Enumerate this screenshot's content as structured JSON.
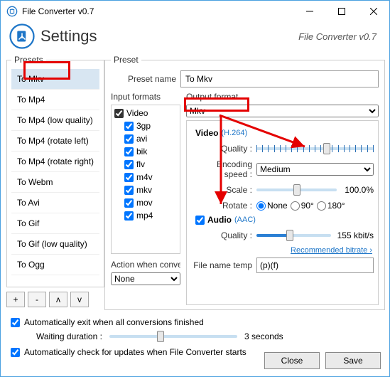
{
  "window": {
    "title": "File Converter v0.7",
    "subtitle": "File Converter v0.7",
    "heading": "Settings"
  },
  "legends": {
    "presets": "Presets",
    "preset": "Preset"
  },
  "presets": {
    "items": [
      {
        "label": "To Mkv"
      },
      {
        "label": "To Mp4"
      },
      {
        "label": "To Mp4 (low quality)"
      },
      {
        "label": "To Mp4 (rotate left)"
      },
      {
        "label": "To Mp4 (rotate right)"
      },
      {
        "label": "To Webm"
      },
      {
        "label": "To Avi"
      },
      {
        "label": "To Gif"
      },
      {
        "label": "To Gif (low quality)"
      },
      {
        "label": "To Ogg"
      }
    ],
    "buttons": {
      "add": "+",
      "remove": "-",
      "up": "ᴧ",
      "down": "v"
    }
  },
  "preset": {
    "name_label": "Preset name",
    "name_value": "To Mkv",
    "input_formats_label": "Input formats",
    "formats": [
      {
        "label": "Video",
        "checked": true,
        "icon": true
      },
      {
        "label": "3gp",
        "checked": true
      },
      {
        "label": "avi",
        "checked": true
      },
      {
        "label": "bik",
        "checked": true
      },
      {
        "label": "flv",
        "checked": true
      },
      {
        "label": "m4v",
        "checked": true
      },
      {
        "label": "mkv",
        "checked": true
      },
      {
        "label": "mov",
        "checked": true
      },
      {
        "label": "mp4",
        "checked": true
      }
    ],
    "action_label": "Action when conversion",
    "action_value": "None",
    "output_label": "Output format",
    "output_value": "Mkv",
    "video": {
      "heading": "Video",
      "codec": "(H.264)",
      "quality_label": "Quality :",
      "speed_label": "Encoding speed :",
      "speed_value": "Medium",
      "scale_label": "Scale :",
      "scale_value": "100.0%",
      "rotate_label": "Rotate :",
      "rotate_options": [
        "None",
        "90°",
        "180°"
      ],
      "rotate_selected": "None"
    },
    "audio": {
      "heading": "Audio",
      "codec": "(AAC)",
      "quality_label": "Quality :",
      "bitrate": "155 kbit/s",
      "recommend": "Recommended bitrate ›"
    },
    "filename_label": "File name temp",
    "filename_value": "(p)(f)"
  },
  "bottom": {
    "auto_exit": "Automatically exit when all conversions finished",
    "waiting_label": "Waiting duration :",
    "waiting_value": "3 seconds",
    "auto_update": "Automatically check for updates when File Converter starts",
    "close": "Close",
    "save": "Save"
  }
}
